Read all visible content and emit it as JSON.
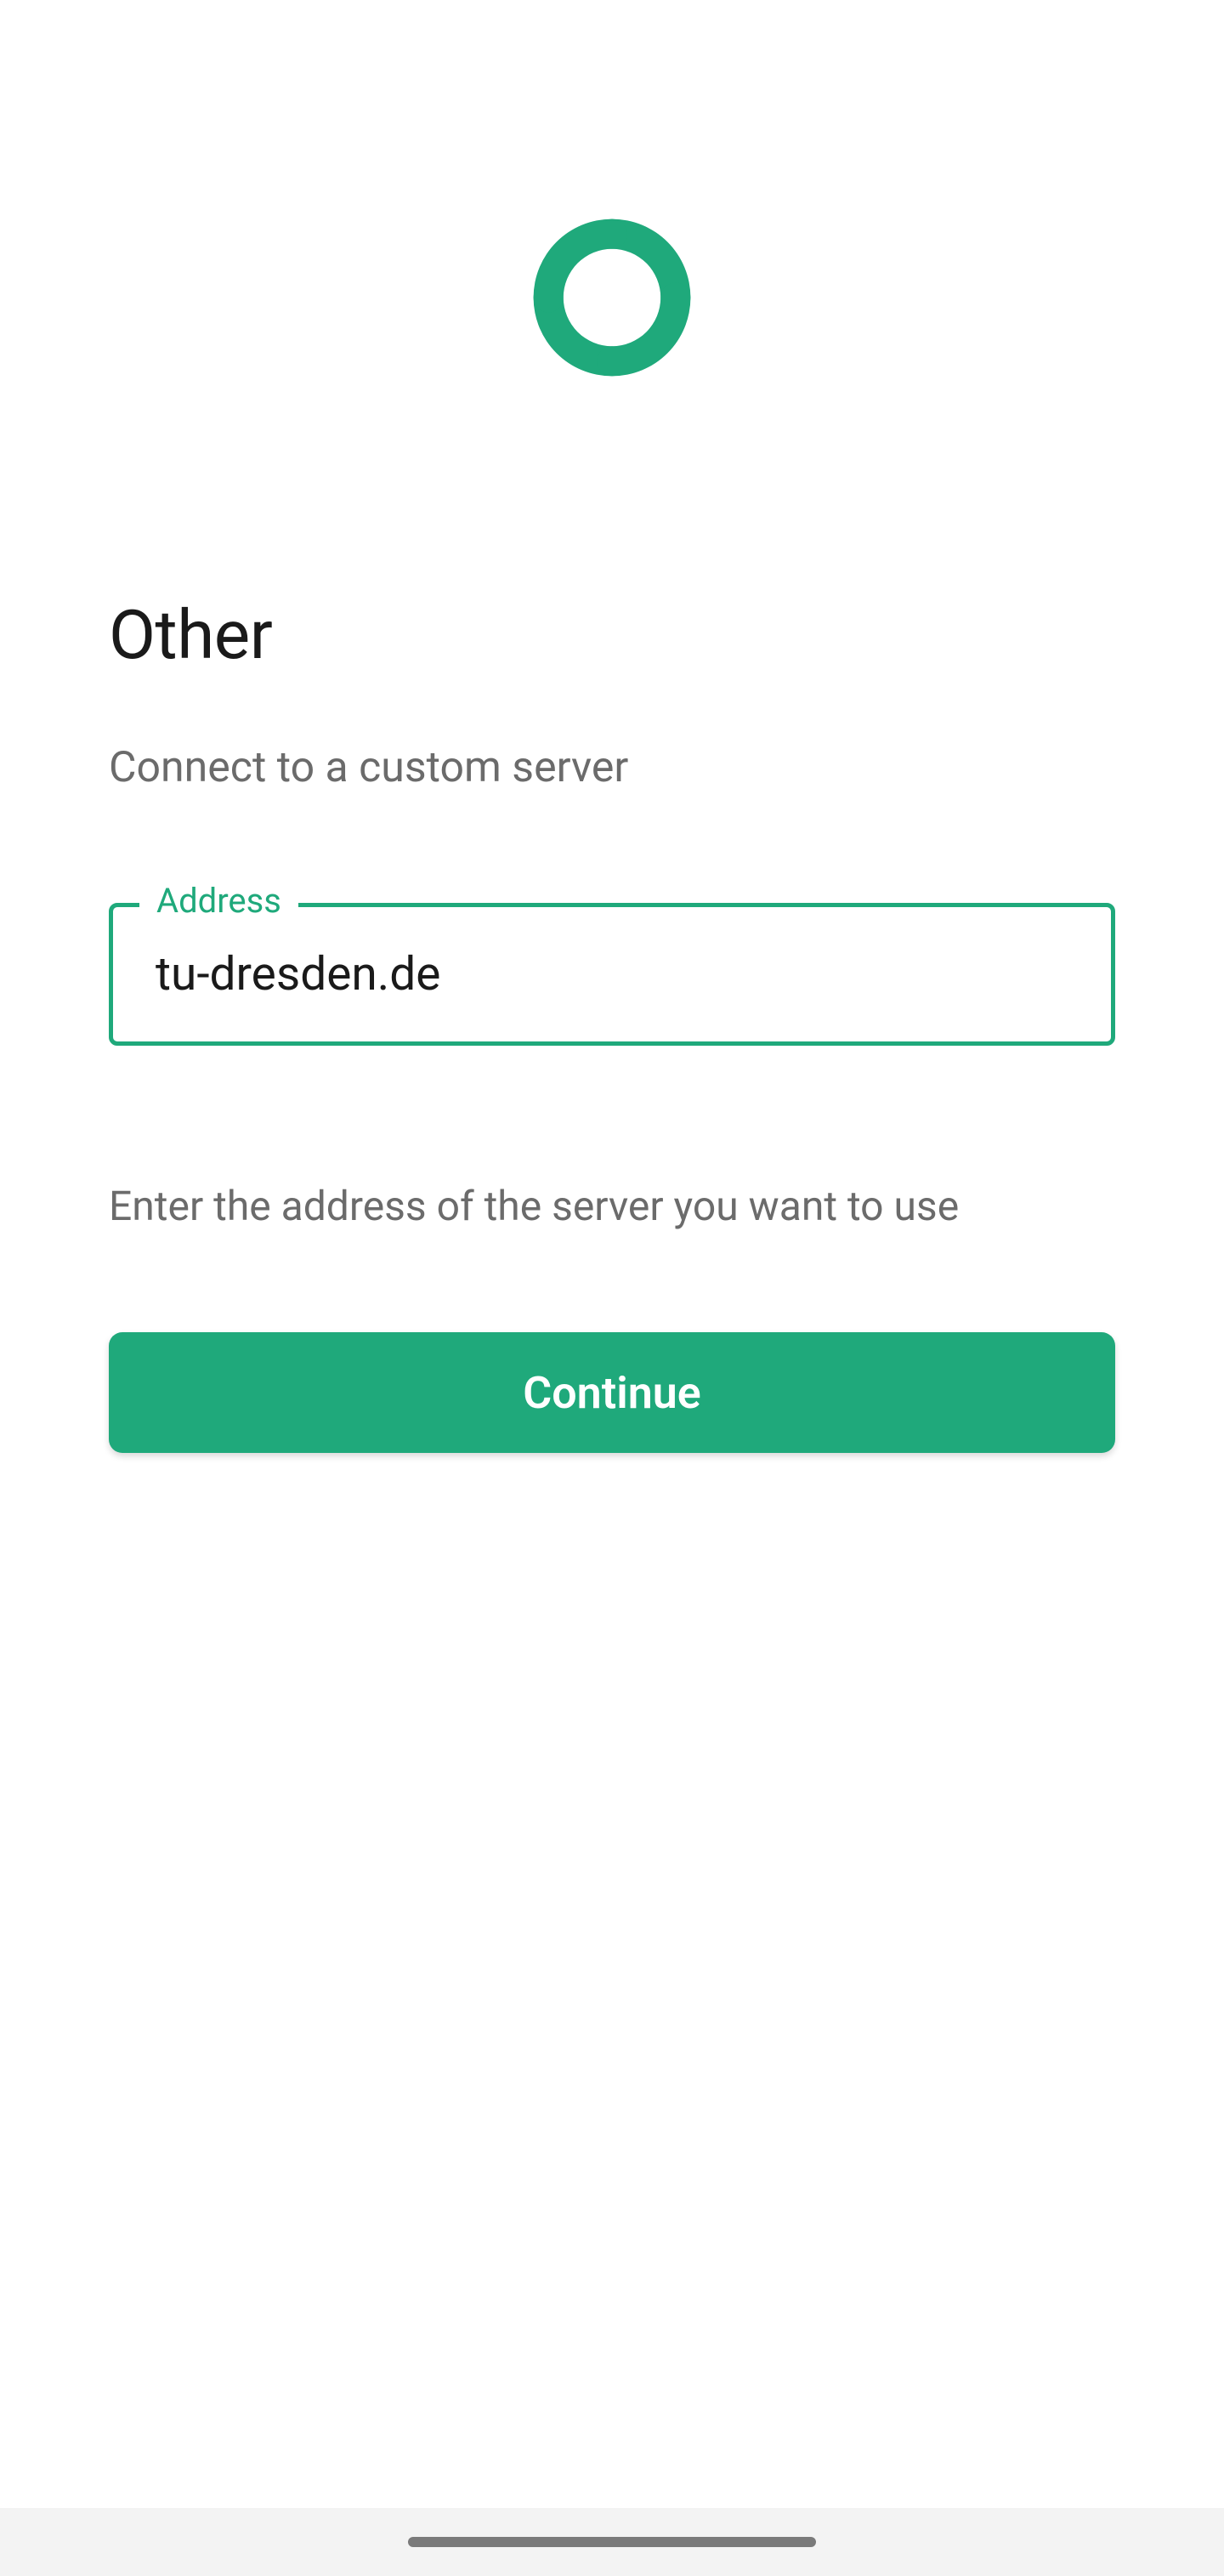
{
  "page": {
    "title": "Other",
    "subtitle": "Connect to a custom server"
  },
  "input": {
    "label": "Address",
    "value": "tu-dresden.de"
  },
  "helper": {
    "text": "Enter the address of the server you want to use"
  },
  "button": {
    "continue_label": "Continue"
  },
  "colors": {
    "accent": "#1fa97b"
  }
}
